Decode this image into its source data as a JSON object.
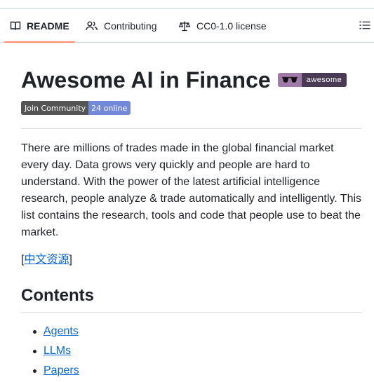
{
  "tabs": [
    {
      "label": "README",
      "icon": "book-icon",
      "active": true
    },
    {
      "label": "Contributing",
      "icon": "people-icon",
      "active": false
    },
    {
      "label": "CC0-1.0 license",
      "icon": "law-scale-icon",
      "active": false
    }
  ],
  "outline_icon": "list-unordered-icon",
  "readme": {
    "title": "Awesome AI in Finance",
    "awesome_badge": {
      "icon": "sunglasses-icon",
      "label": "awesome"
    },
    "community_badge": {
      "left": "Join Community",
      "right": "24 online"
    },
    "intro": "There are millions of trades made in the global financial market every day. Data grows very quickly and people are hard to understand. With the power of the latest artificial intelligence research, people analyze & trade automatically and intelligently. This list contains the research, tools and code that people use to beat the market.",
    "cn_link": {
      "open": "[",
      "text": "中文资源",
      "close": "]"
    },
    "contents_heading": "Contents",
    "contents": [
      "Agents",
      "LLMs",
      "Papers"
    ]
  },
  "colors": {
    "active_tab_underline": "#fd8c73",
    "link": "#0969da",
    "community_right": "#7289da",
    "awesome_right": "#4a3a54"
  }
}
